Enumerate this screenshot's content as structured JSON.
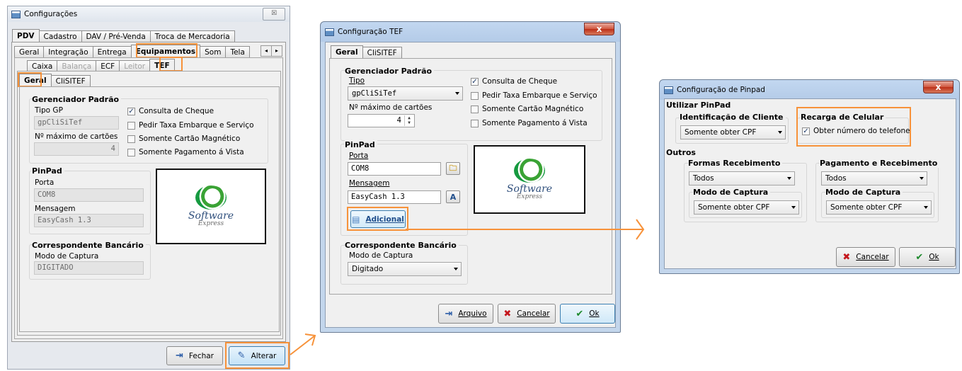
{
  "colors": {
    "highlight": "#f7923a",
    "accent_blue": "#1f4e8c",
    "cancel_red": "#c4161c",
    "ok_green": "#1d8a2d"
  },
  "win1": {
    "title": "Configurações",
    "close_glyph": "☒",
    "main_tabs": [
      "PDV",
      "Cadastro",
      "DAV / Pré-Venda",
      "Troca de Mercadoria"
    ],
    "sub_tabs": [
      "Geral",
      "Integração",
      "Entrega",
      "Equipamentos",
      "Som",
      "Tela"
    ],
    "scroll_glyphs": [
      "◂",
      "▸"
    ],
    "equip_tabs": [
      "Caixa",
      "Balança",
      "ECF",
      "Leitor",
      "TEF"
    ],
    "tef_tabs": [
      "Geral",
      "CliSITEF"
    ],
    "group_gerenciador": "Gerenciador Padrão",
    "tipo_gp_label": "Tipo GP",
    "tipo_gp_value": "gpCliSiTef",
    "max_cartoes_label": "Nº máximo de cartões",
    "max_cartoes_value": "4",
    "chk_consulta": "Consulta de Cheque",
    "chk_taxa": "Pedir Taxa Embarque e Serviço",
    "chk_magnetico": "Somente Cartão Magnético",
    "chk_avista": "Somente Pagamento á Vista",
    "group_pinpad": "PinPad",
    "porta_label": "Porta",
    "porta_value": "COM8",
    "mensagem_label": "Mensagem",
    "mensagem_value": "EasyCash 1.3",
    "group_correspondente": "Correspondente Bancário",
    "modo_captura_label": "Modo de Captura",
    "modo_captura_value": "DIGITADO",
    "btn_fechar": "Fechar",
    "btn_alterar": "Alterar"
  },
  "win2": {
    "title": "Configuração TEF",
    "close_glyph": "x",
    "tabs": [
      "Geral",
      "CliSITEF"
    ],
    "group_gerenciador": "Gerenciador Padrão",
    "tipo_label": "Tipo",
    "tipo_value": "gpCliSiTef",
    "max_label": "Nº máximo de cartões",
    "max_value": "4",
    "chk_consulta": "Consulta de Cheque",
    "chk_taxa": "Pedir Taxa Embarque e Serviço",
    "chk_magnetico": "Somente Cartão Magnético",
    "chk_avista": "Somente Pagamento á Vista",
    "group_pinpad": "PinPad",
    "porta_label": "Porta",
    "porta_value": "COM8",
    "mensagem_label": "Mensagem",
    "mensagem_value": "EasyCash 1.3",
    "btn_adicional": "Adicional",
    "group_correspondente": "Correspondente Bancário",
    "modo_label": "Modo de Captura",
    "modo_value": "Digitado",
    "btn_arquivo": "Arquivo",
    "btn_cancelar": "Cancelar",
    "btn_ok": "Ok"
  },
  "win3": {
    "title": "Configuração de Pinpad",
    "close_glyph": "x",
    "group_utilizar": "Utilizar PinPad",
    "group_identificacao": "Identificação de Cliente",
    "identificacao_value": "Somente obter CPF",
    "group_recarga": "Recarga de Celular",
    "chk_telefone": "Obter número do telefone",
    "group_outros": "Outros",
    "group_formas": "Formas Recebimento",
    "formas_value": "Todos",
    "formas_modo_label": "Modo de Captura",
    "formas_modo_value": "Somente obter CPF",
    "group_pagamento": "Pagamento e Recebimento",
    "pagamento_value": "Todos",
    "pagamento_modo_label": "Modo de Captura",
    "pagamento_modo_value": "Somente obter CPF",
    "btn_cancelar": "Cancelar",
    "btn_ok": "Ok"
  },
  "logo": {
    "line1": "Software",
    "line2": "Express"
  }
}
